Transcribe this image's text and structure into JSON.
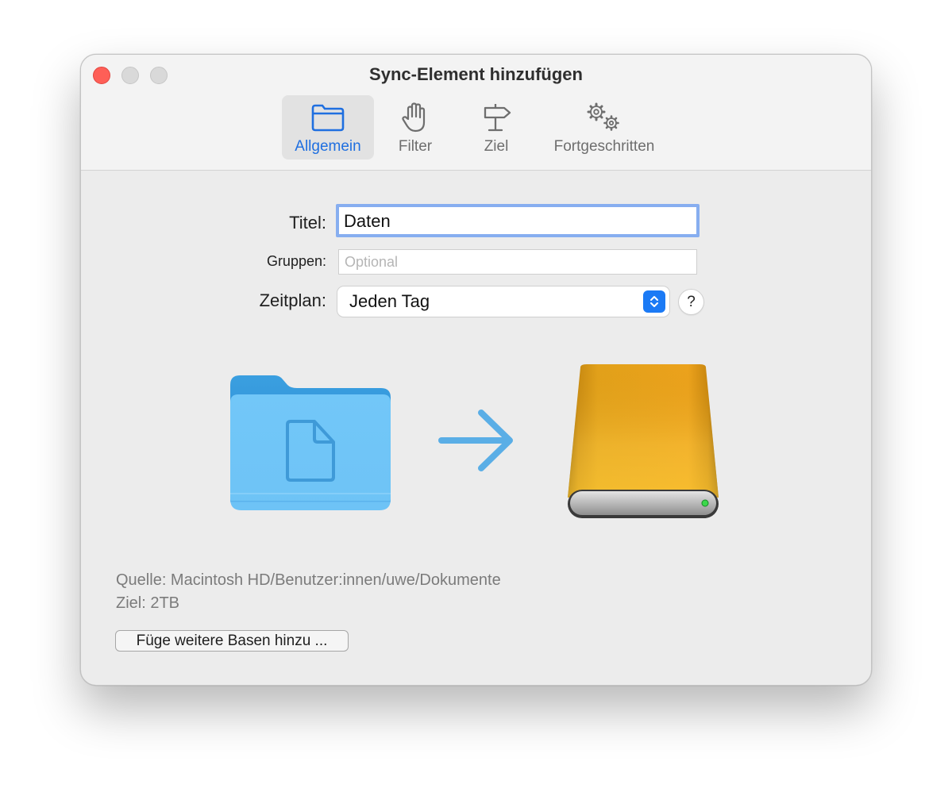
{
  "window": {
    "title": "Sync-Element hinzufügen"
  },
  "tabs": [
    {
      "label": "Allgemein",
      "icon": "folder-icon",
      "active": true
    },
    {
      "label": "Filter",
      "icon": "hand-icon",
      "active": false
    },
    {
      "label": "Ziel",
      "icon": "signpost-icon",
      "active": false
    },
    {
      "label": "Fortgeschritten",
      "icon": "gears-icon",
      "active": false
    }
  ],
  "form": {
    "title_label": "Titel:",
    "title_value": "Daten",
    "groups_label": "Gruppen:",
    "groups_placeholder": "Optional",
    "schedule_label": "Zeitplan:",
    "schedule_value": "Jeden Tag",
    "help_label": "?"
  },
  "sync": {
    "source_icon": "folder-icon",
    "direction_icon": "arrow-right-icon",
    "target_icon": "external-drive-icon"
  },
  "info": {
    "source": "Quelle: Macintosh HD/Benutzer:innen/uwe/Dokumente",
    "target": "Ziel: 2TB"
  },
  "buttons": {
    "add_bases": "Füge weitere Basen hinzu ..."
  },
  "colors": {
    "accent": "#1f6fe0",
    "close": "#fe5f57",
    "drive": "#e8a51a",
    "folder": "#6cc3f7"
  }
}
